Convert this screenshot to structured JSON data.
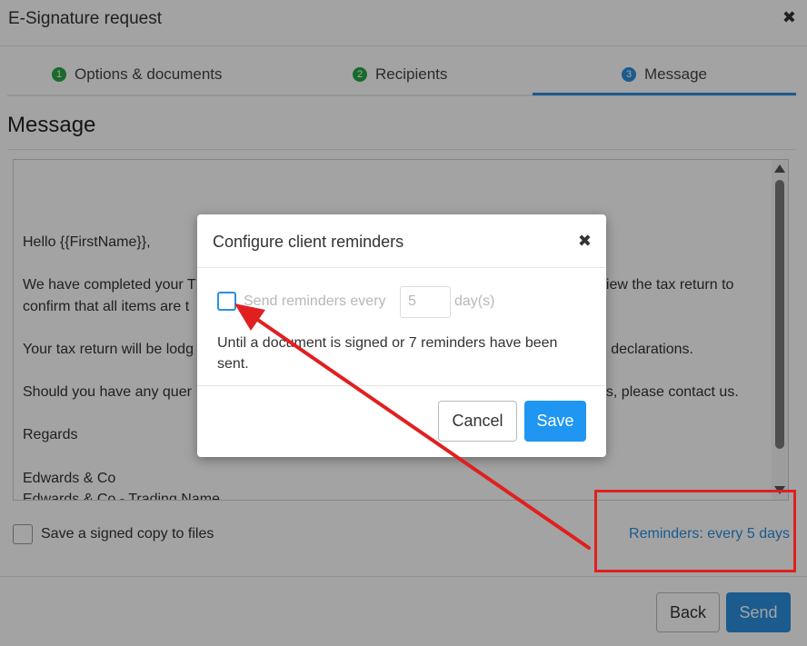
{
  "window": {
    "title": "E-Signature request"
  },
  "steps": [
    {
      "num": "1",
      "label": "Options & documents"
    },
    {
      "num": "2",
      "label": "Recipients"
    },
    {
      "num": "3",
      "label": "Message"
    }
  ],
  "message": {
    "title": "Message",
    "lines": [
      "Hello {{FirstName}},",
      "We have completed your T",
      "eview the tax return to",
      "confirm that all items are t",
      "Your tax return will be lodg",
      "ed declarations.",
      "Should you have any quer",
      "ess, please contact us.",
      "Regards",
      "Edwards & Co",
      "Edwards & Co - Trading Name"
    ]
  },
  "footer": {
    "save_copy_label": "Save a signed copy to files",
    "reminders_link": "Reminders: every 5 days",
    "back_label": "Back",
    "send_label": "Send"
  },
  "modal": {
    "title": "Configure client reminders",
    "checkbox_label": "Send reminders every",
    "input_value": "5",
    "unit_label": "day(s)",
    "note": "Until a document is signed or 7 reminders have been sent.",
    "cancel_label": "Cancel",
    "save_label": "Save"
  },
  "colors": {
    "accent": "#2b8fde",
    "step_done": "#28a745",
    "annotation": "#e02020"
  }
}
